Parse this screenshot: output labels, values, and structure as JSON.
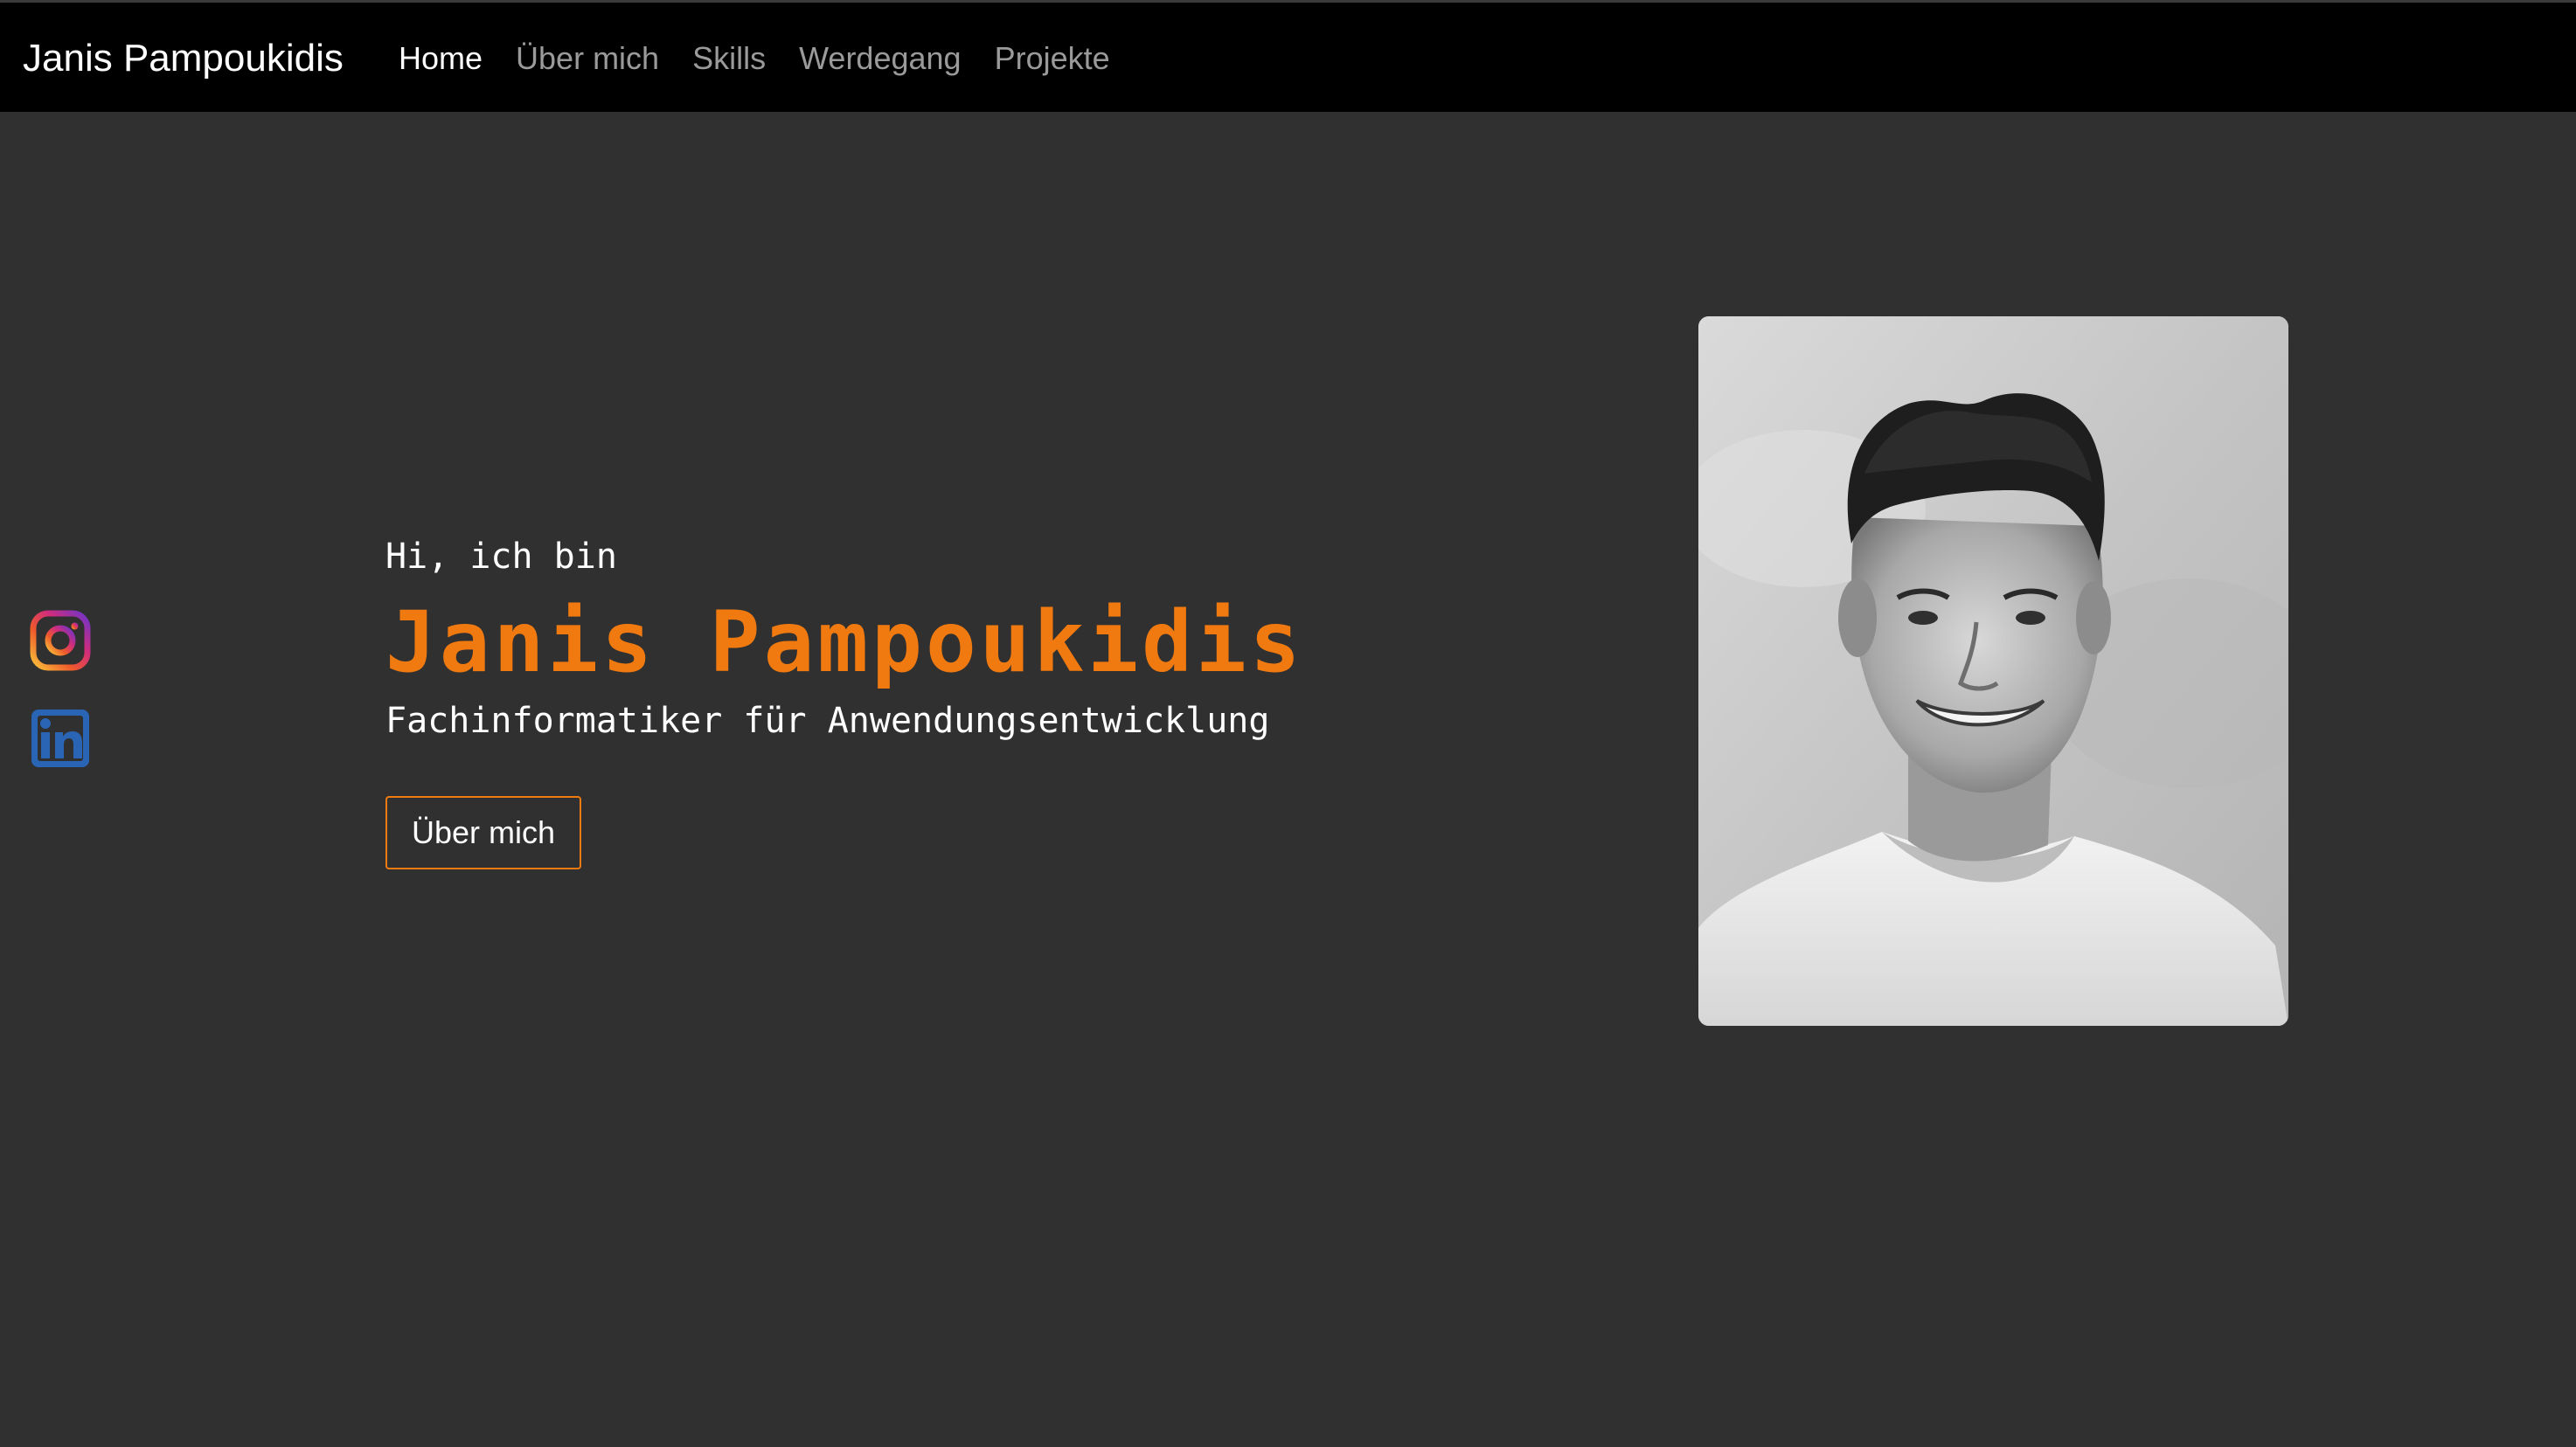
{
  "nav": {
    "brand": "Janis Pampoukidis",
    "links": [
      {
        "label": "Home",
        "active": true
      },
      {
        "label": "Über mich",
        "active": false
      },
      {
        "label": "Skills",
        "active": false
      },
      {
        "label": "Werdegang",
        "active": false
      },
      {
        "label": "Projekte",
        "active": false
      }
    ]
  },
  "social": [
    {
      "icon": "instagram-icon"
    },
    {
      "icon": "linkedin-icon"
    }
  ],
  "hero": {
    "greeting": "Hi, ich bin",
    "name": "Janis Pampoukidis",
    "subtitle": "Fachinformatiker für Anwendungsentwicklung",
    "cta_label": "Über mich"
  },
  "portrait": {
    "description": "black-and-white portrait photo"
  },
  "colors": {
    "background": "#303030",
    "navbar": "#000000",
    "accent": "#f07a10",
    "nav_inactive": "#9a9a9a",
    "text": "#ffffff",
    "linkedin": "#2a64b4"
  }
}
